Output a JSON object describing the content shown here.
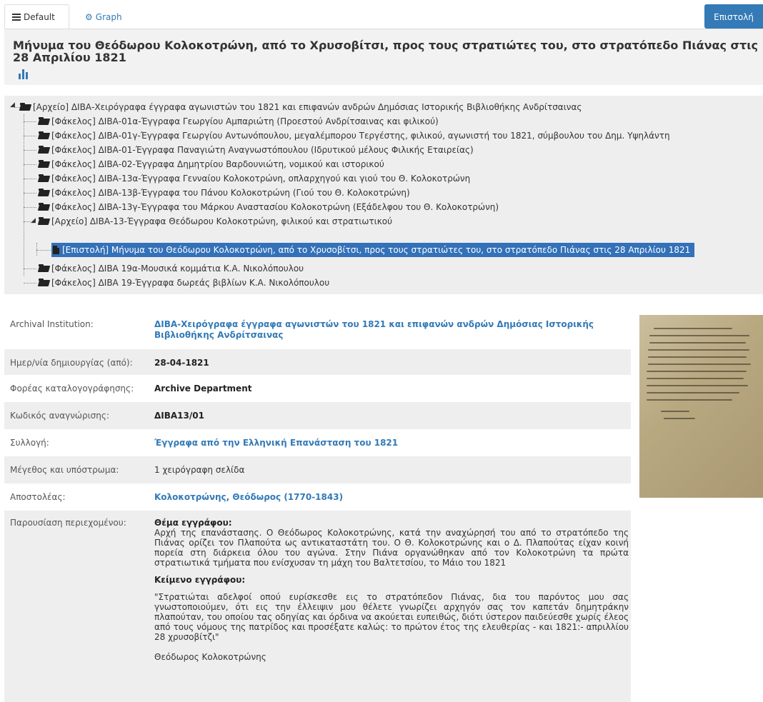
{
  "tabs": {
    "default_label": "Default",
    "graph_label": "Graph"
  },
  "header": {
    "button_label": "Επιστολή",
    "title": "Μήνυμα του Θεόδωρου Κολοκοτρώνη, από το Χρυσοβίτσι, προς τους στρατιώτες του, στο στρατόπεδο Πιάνας στις 28 Απριλίου 1821"
  },
  "tree": {
    "root": "[Αρχείο] ΔΙΒΑ-Χειρόγραφα έγγραφα αγωνιστών του 1821 και επιφανών ανδρών Δημόσιας Ιστορικής Βιβλιοθήκης Ανδρίτσαινας",
    "folders": [
      "[Φάκελος] ΔΙΒΑ-01α-Έγγραφα Γεωργίου Αμπαριώτη (Προεστού Ανδρίτσαινας και φιλικού)",
      "[Φάκελος] ΔΙΒΑ-01γ-Έγγραφα Γεωργίου Αντωνόπουλου, μεγαλέμπορου Τεργέστης, φιλικού, αγωνιστή του 1821, σύμβουλου του Δημ. Υψηλάντη",
      "[Φάκελος] ΔΙΒΑ-01-Έγγραφα Παναγιώτη Αναγνωστόπουλου (Ιδρυτικού μέλους Φιλικής Εταιρείας)",
      "[Φάκελος] ΔΙΒΑ-02-Έγγραφα Δημητρίου Βαρδουνιώτη, νομικού και ιστορικού",
      "[Φάκελος] ΔΙΒΑ-13α-Έγγραφα Γενναίου Κολοκοτρώνη, οπλαρχηγού και γιού του Θ. Κολοκοτρώνη",
      "[Φάκελος] ΔΙΒΑ-13β-Έγγραφα του Πάνου Κολοκοτρώνη (Γιού του Θ. Κολοκοτρώνη)",
      "[Φάκελος] ΔΙΒΑ-13γ-Έγγραφα του Μάρκου Αναστασίου Κολοκοτρώνη (Εξάδελφου του Θ. Κολοκοτρώνη)"
    ],
    "archive": "[Αρχείο] ΔΙΒΑ-13-Έγγραφα Θεόδωρου Κολοκοτρώνη, φιλικού και στρατιωτικού",
    "selected": "[Επιστολή] Μήνυμα του Θεόδωρου Κολοκοτρώνη, από το Χρυσοβίτσι, προς τους στρατιώτες του, στο στρατόπεδο Πιάνας στις 28 Απριλίου 1821",
    "after": [
      "[Φάκελος] ΔΙΒΑ 19α-Μουσικά κομμάτια Κ.Α. Νικολόπουλου",
      "[Φάκελος] ΔΙΒΑ 19-Έγγραφα δωρεάς βιβλίων Κ.Α. Νικολόπουλου"
    ]
  },
  "metadata": {
    "rows": [
      {
        "label": "Archival Institution:",
        "value": "ΔΙΒΑ-Χειρόγραφα έγγραφα αγωνιστών του 1821 και επιφανών ανδρών Δημόσιας Ιστορικής Βιβλιοθήκης Ανδρίτσαινας"
      },
      {
        "label": "Ημερ/νία δημιουργίας (από):",
        "value": "28-04-1821"
      },
      {
        "label": "Φορέας καταλογογράφησης:",
        "value": "Archive Department"
      },
      {
        "label": "Κωδικός αναγνώρισης:",
        "value": "ΔΙΒΑ13/01"
      },
      {
        "label": "Συλλογή:",
        "value": "Έγγραφα από την Ελληνική Επανάσταση του 1821"
      },
      {
        "label": "Μέγεθος και υπόστρωμα:",
        "value": "1 χειρόγραφη σελίδα"
      },
      {
        "label": "Αποστολέας:",
        "value": "Κολοκοτρώνης, Θεόδωρος (1770-1843)"
      },
      {
        "label": "Παρουσίαση περιεχομένου:",
        "value": ""
      }
    ],
    "content": {
      "subject_heading": "Θέμα εγγράφου:",
      "subject_text": "Αρχή της επανάστασης. Ο Θεόδωρος Κολοκοτρώνης, κατά την αναχώρησή του από το στρατόπεδο της Πιάνας ορίζει τον Πλαπούτα ως αντικαταστάτη του. Ο Θ. Κολοκοτρώνης και ο Δ. Πλαπούτας είχαν κοινή πορεία στη διάρκεια όλου του αγώνα. Στην Πιάνα οργανώθηκαν από τον Κολοκοτρώνη τα πρώτα στρατιωτικά τμήματα που ενίσχυσαν τη μάχη του Βαλτετσίου, το Μάιο του 1821",
      "text_heading": "Κείμενο εγγράφου:",
      "text_body": "\"Στρατιώται αδελφοί οπού ευρίσκεσθε εις το στρατόπεδον Πιάνας, δια του παρόντος μου σας γνωστοποιούμεν, ότι εις την έλλειψιν μου θέλετε γνωρίζει αρχηγόν σας τον καπετάν δημητράκην πλαπούταν, του οποίου τας οδηγίας και όρδινα να ακούεται ευπειθώς, διότι ύστερον παιδεύεσθε χωρίς έλεος από τους νόμους της πατρίδος και προσέξατε καλώς: το πρώτον έτος της ελευθερίας - και 1821:- απριλλίου 28 χρυσοβίτζι\"",
      "signature": "Θεόδωρος Κολοκοτρώνης"
    }
  },
  "colors": {
    "accent": "#337ab7",
    "selected_bg": "#3371b8",
    "panel_bg": "#eeeeee"
  }
}
